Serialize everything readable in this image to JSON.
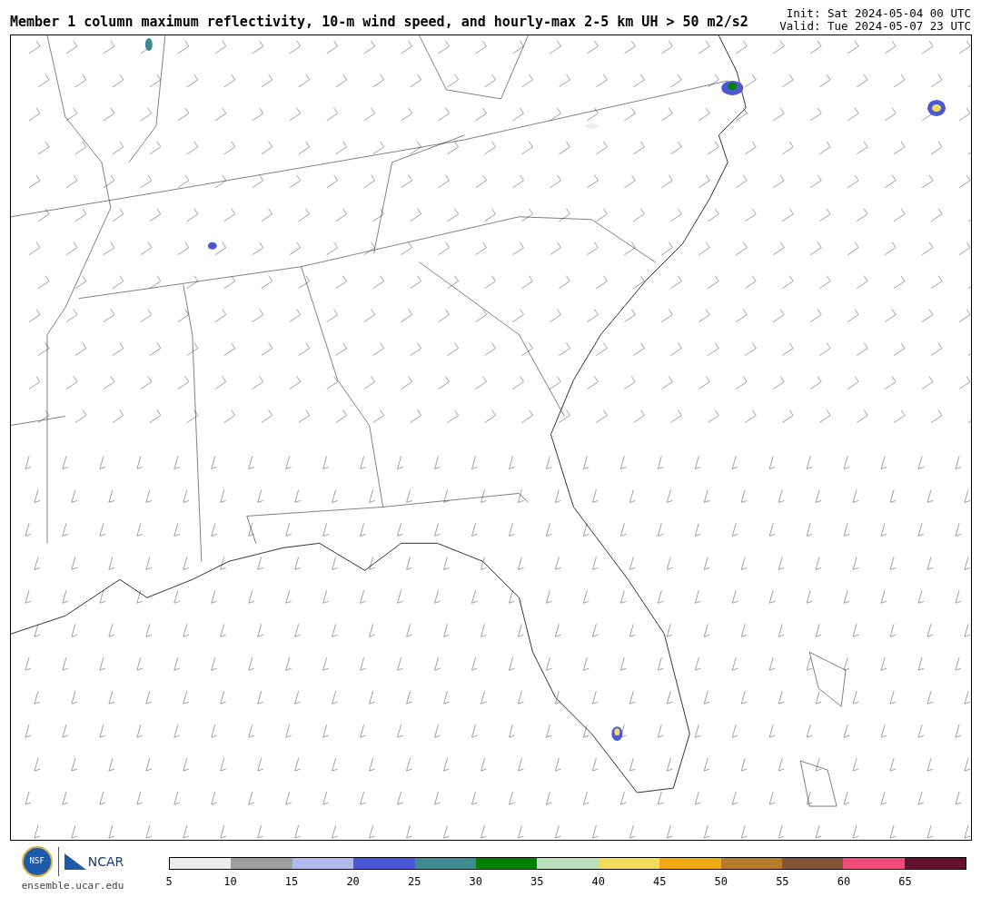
{
  "title": "Member 1 column maximum reflectivity, 10-m wind speed, and hourly-max 2-5 km UH > 50 m2/s2",
  "init": "Init: Sat 2024-05-04 00 UTC",
  "valid": "Valid: Tue 2024-05-07 23 UTC",
  "logos": {
    "nsf": "NSF",
    "ncar": "NCAR"
  },
  "url": "ensemble.ucar.edu",
  "colorbar": {
    "bins": [
      {
        "color": "#ececec"
      },
      {
        "color": "#9e9e9e"
      },
      {
        "color": "#b2b9ec"
      },
      {
        "color": "#4b57d4"
      },
      {
        "color": "#3d8a90"
      },
      {
        "color": "#008000"
      },
      {
        "color": "#badfba"
      },
      {
        "color": "#f2dc5a"
      },
      {
        "color": "#f0aa12"
      },
      {
        "color": "#b67c2c"
      },
      {
        "color": "#835536"
      },
      {
        "color": "#ef4c7a"
      },
      {
        "color": "#62122e"
      }
    ],
    "ticks": [
      "5",
      "10",
      "15",
      "20",
      "25",
      "30",
      "35",
      "40",
      "45",
      "50",
      "55",
      "60",
      "65"
    ]
  }
}
